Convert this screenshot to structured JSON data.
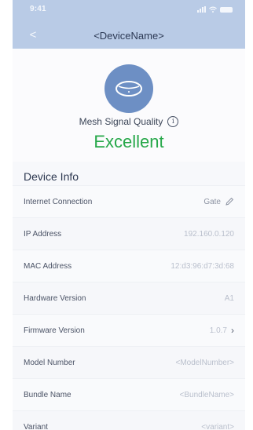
{
  "status_bar": {
    "time": "9:41",
    "icons": [
      "signal-icon",
      "wifi-icon",
      "battery-icon"
    ]
  },
  "nav": {
    "back_glyph": "<",
    "title": "<DeviceName>"
  },
  "hero": {
    "device_icon": "mesh-router-icon",
    "signal_label": "Mesh Signal Quality",
    "info_glyph": "i",
    "signal_value": "Excellent"
  },
  "section": {
    "title": "Device Info"
  },
  "rows": [
    {
      "label": "Internet Connection",
      "value": "Gate"
    },
    {
      "label": "IP Address",
      "value": "192.160.0.120"
    },
    {
      "label": "MAC Address",
      "value": "12:d3:96:d7:3d:68"
    },
    {
      "label": "Hardware Version",
      "value": "A1"
    },
    {
      "label": "Firmware Version",
      "value": "1.0.7"
    },
    {
      "label": "Model Number",
      "value": "<ModelNumber>"
    },
    {
      "label": "Bundle Name",
      "value": "<BundleName>"
    },
    {
      "label": "Variant",
      "value": "<variant>"
    }
  ],
  "colors": {
    "header_band": "#b9cbe6",
    "device_circle": "#6d8fc4",
    "excellent_green": "#27a84a"
  }
}
